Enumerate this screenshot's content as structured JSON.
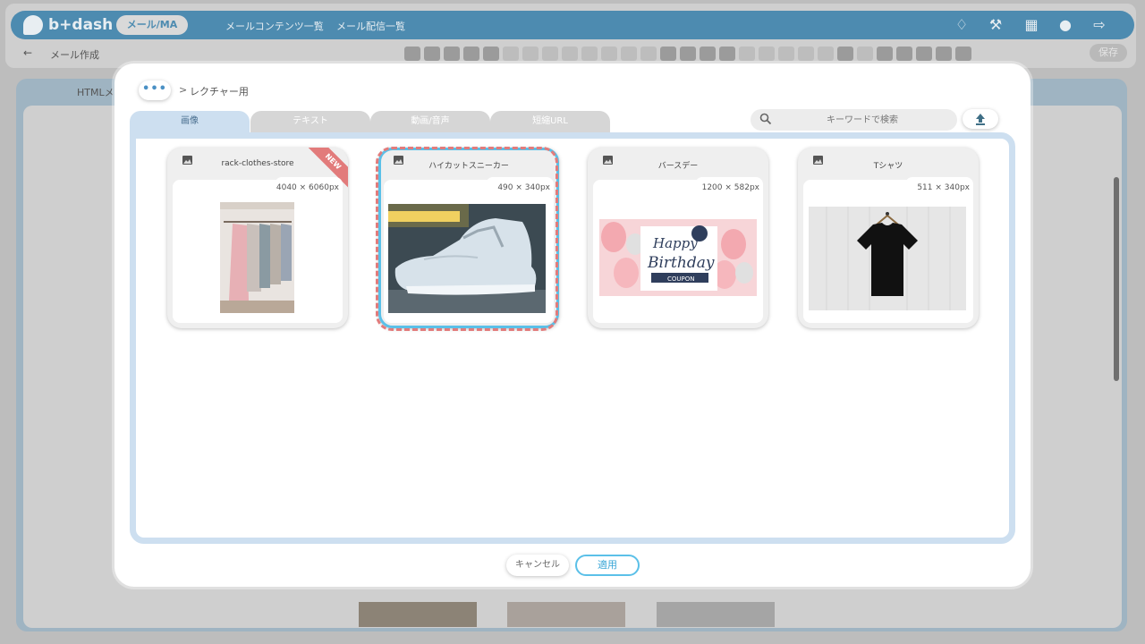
{
  "app": {
    "logo": "b+dash",
    "product_badge": "メール/MA",
    "nav": [
      "メールコンテンツ一覧",
      "メール配信一覧"
    ],
    "subheader": {
      "back_label": "←",
      "title": "メール作成"
    },
    "save_label": "保存",
    "html_tab_label": "HTMLメ",
    "colors": {
      "header": "#4d8bb0",
      "accent": "#5bc0e8",
      "selection": "#e27b7b"
    }
  },
  "dialog": {
    "more_label": "•••",
    "breadcrumb_sep": ">",
    "breadcrumb": "レクチャー用",
    "tabs": [
      "画像",
      "テキスト",
      "動画/音声",
      "短縮URL"
    ],
    "active_tab": "画像",
    "search": {
      "placeholder": "キーワードで検索",
      "value": ""
    },
    "upload_icon": "upload-icon",
    "images": [
      {
        "name": "rack-clothes-store",
        "size": "4040 × 6060px",
        "badge": "NEW",
        "selected": false
      },
      {
        "name": "ハイカットスニーカー",
        "size": "490 × 340px",
        "badge": "",
        "selected": true
      },
      {
        "name": "バースデー",
        "size": "1200 × 582px",
        "badge": "",
        "selected": false
      },
      {
        "name": "Tシャツ",
        "size": "511 × 340px",
        "badge": "",
        "selected": false
      }
    ],
    "birthday_text": {
      "line1": "Happy",
      "line2": "Birthday",
      "line3": "COUPON"
    },
    "buttons": {
      "cancel": "キャンセル",
      "apply": "適用"
    }
  }
}
